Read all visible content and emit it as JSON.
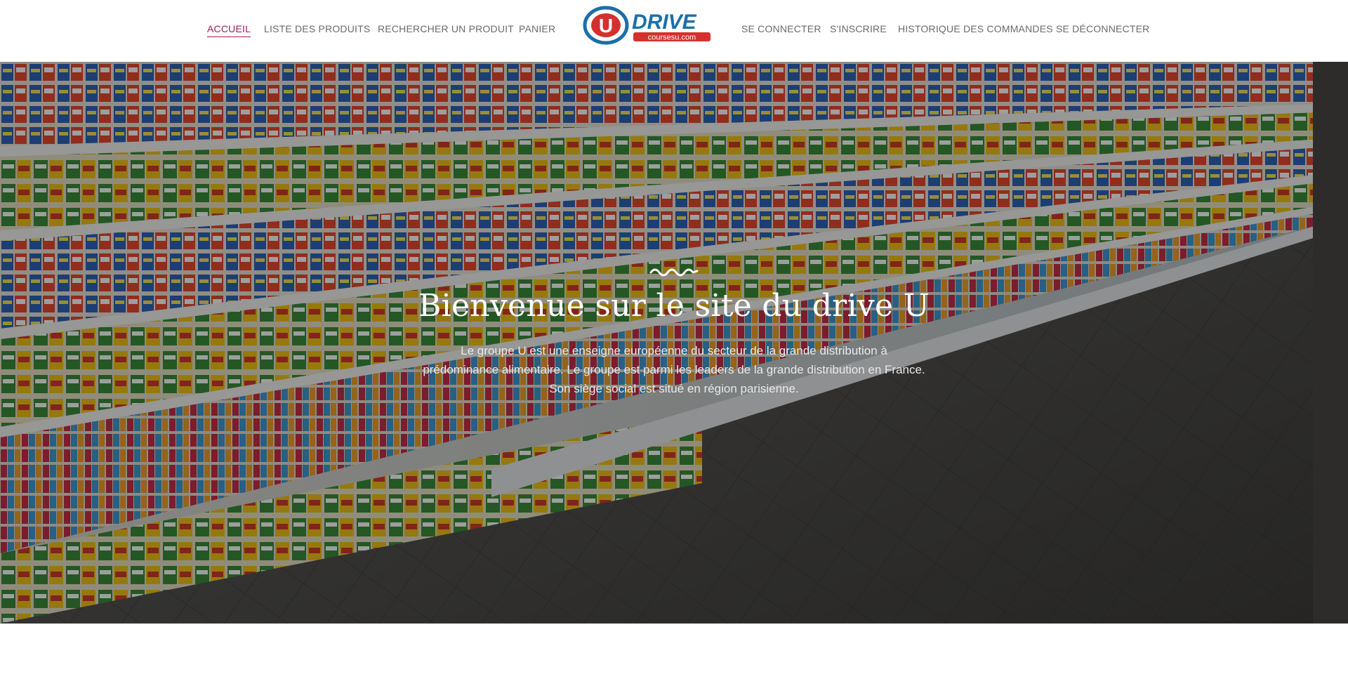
{
  "nav": {
    "left_items": [
      {
        "label": "ACCUEIL",
        "active": true
      },
      {
        "label": "LISTE DES PRODUITS",
        "active": false
      },
      {
        "label": "RECHERCHER UN PRODUIT",
        "active": false
      },
      {
        "label": "PANIER",
        "active": false
      }
    ],
    "right_items": [
      {
        "label": "SE CONNECTER"
      },
      {
        "label": "S'INSCRIRE"
      },
      {
        "label": "HISTORIQUE DES COMMANDES"
      },
      {
        "label": "SE DÉCONNECTER"
      }
    ],
    "active_color": "#9b1f5e"
  },
  "logo": {
    "letter": "U",
    "word": "DRIVE",
    "domain": "coursesu.com",
    "colors": {
      "blue": "#1c6fa8",
      "red": "#d4312e"
    }
  },
  "hero": {
    "title": "Bienvenue sur le site du drive U",
    "text": "Le groupe U est une enseigne européenne du secteur de la grande distribution à prédominance alimentaire. Le groupe est parmi les leaders de la grande distribution en France. Son siège social est situé en région parisienne.",
    "background_description_icon": "supermarket-aisle-photo"
  }
}
